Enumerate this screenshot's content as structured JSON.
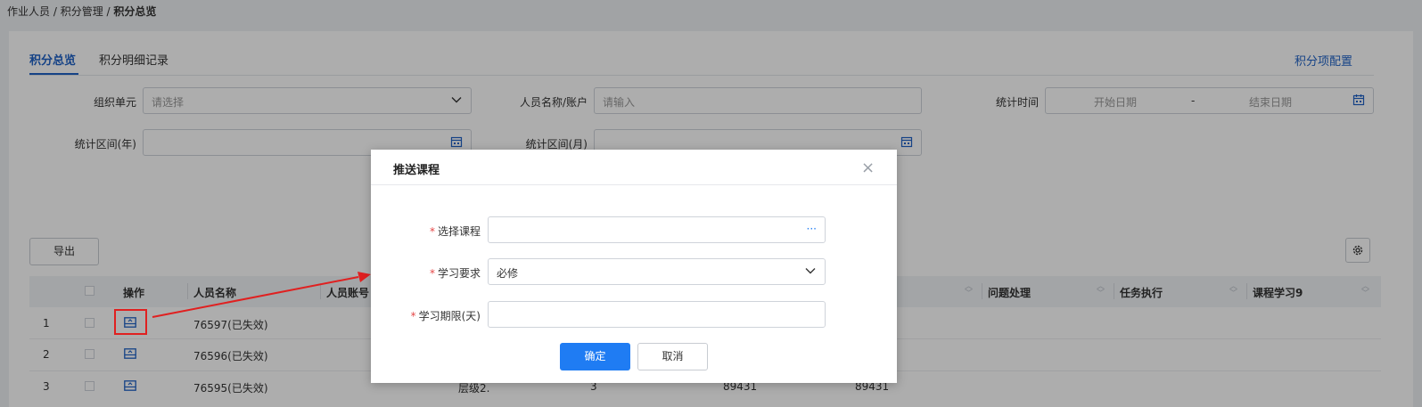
{
  "breadcrumb": {
    "item1": "作业人员",
    "sep": " / ",
    "item2": "积分管理",
    "current": "积分总览"
  },
  "tabs": [
    {
      "label": "积分总览",
      "active": true
    },
    {
      "label": "积分明细记录",
      "active": false
    }
  ],
  "config_link": "积分项配置",
  "filters": {
    "org_label": "组织单元",
    "org_placeholder": "请选择",
    "name_label": "人员名称/账户",
    "name_placeholder": "请输入",
    "time_label": "统计时间",
    "start_placeholder": "开始日期",
    "range_sep": "-",
    "end_placeholder": "结束日期",
    "year_label": "统计区间(年)",
    "month_label": "统计区间(月)"
  },
  "export_label": "导出",
  "table": {
    "headers": [
      "操作",
      "人员名称",
      "人员账号",
      "问题处理",
      "任务执行",
      "课程学习9"
    ],
    "rows": [
      {
        "index": "1",
        "name": "76597(已失效)"
      },
      {
        "index": "2",
        "name": "76596(已失效)"
      },
      {
        "index": "3",
        "name": "76595(已失效)",
        "level": "层级2.",
        "col4": "3",
        "col5": "89431",
        "col6": "89431"
      }
    ]
  },
  "modal": {
    "title": "推送课程",
    "close": "×",
    "fields": [
      {
        "label": "选择课程",
        "value": "",
        "suffix": "···"
      },
      {
        "label": "学习要求",
        "value": "必修"
      },
      {
        "label": "学习期限(天)",
        "value": ""
      }
    ],
    "confirm": "确定",
    "cancel": "取消"
  },
  "colors": {
    "accent": "#1f62c6",
    "primary_button": "#1f7cf3",
    "annotation": "#e02020"
  },
  "icons": [
    "calendar-icon",
    "chevron-down-icon",
    "gear-icon",
    "push-course-icon",
    "close-icon"
  ]
}
